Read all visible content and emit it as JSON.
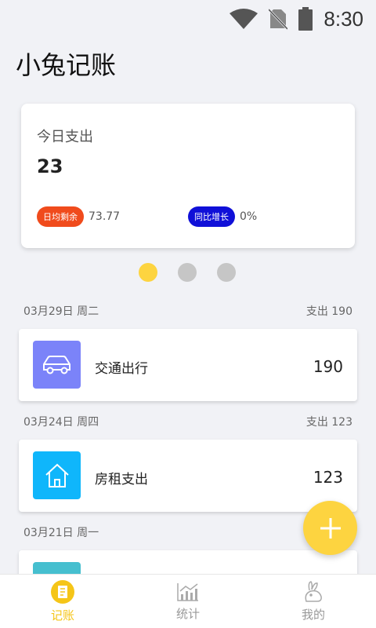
{
  "status": {
    "time": "8:30"
  },
  "app_title": "小兔记账",
  "summary": {
    "label": "今日支出",
    "value": "23",
    "daily_remaining_label": "日均剩余",
    "daily_remaining_value": "73.77",
    "yoy_label": "同比增长",
    "yoy_value": "0%"
  },
  "carousel": {
    "pages": 3,
    "active": 0
  },
  "days": [
    {
      "date": "03月29日 周二",
      "total": "支出 190"
    },
    {
      "date": "03月24日 周四",
      "total": "支出 123"
    },
    {
      "date": "03月21日 周一",
      "total": ""
    }
  ],
  "records": [
    {
      "name": "交通出行",
      "amount": "190",
      "icon": "car-icon",
      "color": "#7b83f9"
    },
    {
      "name": "房租支出",
      "amount": "123",
      "icon": "home-icon",
      "color": "#0fb6fb"
    },
    {
      "name": "",
      "amount": "",
      "icon": "play-icon",
      "color": "#46bfcf"
    }
  ],
  "nav": [
    {
      "label": "记账",
      "icon": "notebook-icon",
      "active": true
    },
    {
      "label": "统计",
      "icon": "chart-icon",
      "active": false
    },
    {
      "label": "我的",
      "icon": "rabbit-icon",
      "active": false
    }
  ],
  "colors": {
    "accent": "#fdd440",
    "active_text": "#f5c518"
  }
}
